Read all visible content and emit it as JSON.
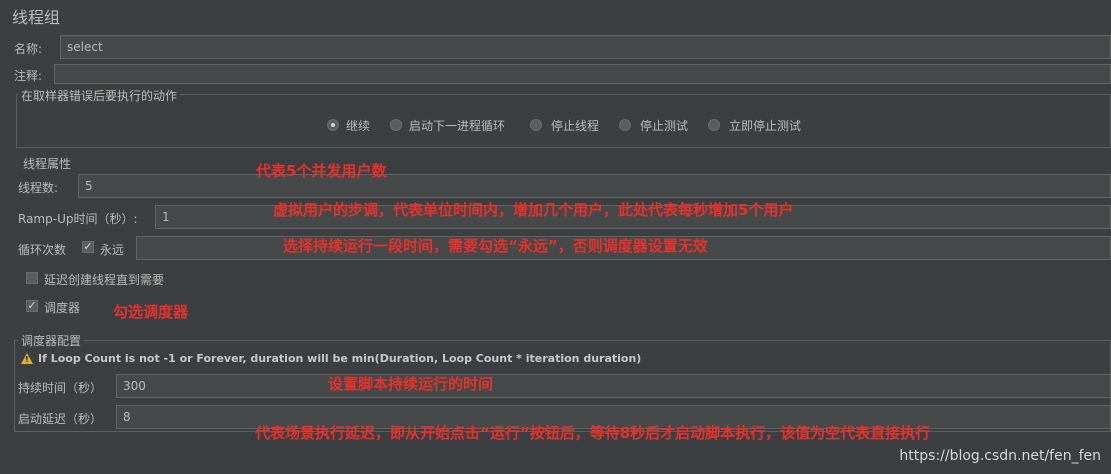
{
  "title": "线程组",
  "name": {
    "label": "名称:",
    "value": "select"
  },
  "comment": {
    "label": "注释:",
    "value": ""
  },
  "sampler_error": {
    "legend": "在取样器错误后要执行的动作",
    "options": [
      "继续",
      "启动下一进程循环",
      "停止线程",
      "停止测试",
      "立即停止测试"
    ],
    "selected": "继续"
  },
  "thread_props": {
    "legend": "线程属性",
    "threads_label": "线程数:",
    "threads_value": "5",
    "rampup_label": "Ramp-Up时间（秒）:",
    "rampup_value": "1",
    "loop_label": "循环次数",
    "forever_label": "永远",
    "forever_checked": true,
    "loop_value": "",
    "delay_label": "延迟创建线程直到需要",
    "delay_checked": false,
    "scheduler_label": "调度器",
    "scheduler_checked": true
  },
  "scheduler_config": {
    "legend": "调度器配置",
    "warning": "If Loop Count is not -1 or Forever, duration will be min(Duration, Loop Count * iteration duration)",
    "duration_label": "持续时间（秒）",
    "duration_value": "300",
    "startup_label": "启动延迟（秒）",
    "startup_value": "8"
  },
  "annotations": {
    "a1": "代表5个并发用户数",
    "a2": "虚拟用户的步调，代表单位时间内，增加几个用户，此处代表每秒增加5个用户",
    "a3": "选择持续运行一段时间，需要勾选“永远”，否则调度器设置无效",
    "a4": "勾选调度器",
    "a5": "设置脚本持续运行的时间",
    "a6": "代表场景执行延迟，即从开始点击“运行”按钮后，等待8秒后才启动脚本执行，该值为空代表直接执行"
  },
  "watermark": "https://blog.csdn.net/fen_fen",
  "colors": {
    "background": "#3c3f41",
    "annotation": "#e8312b",
    "warning": "#e0b030"
  }
}
